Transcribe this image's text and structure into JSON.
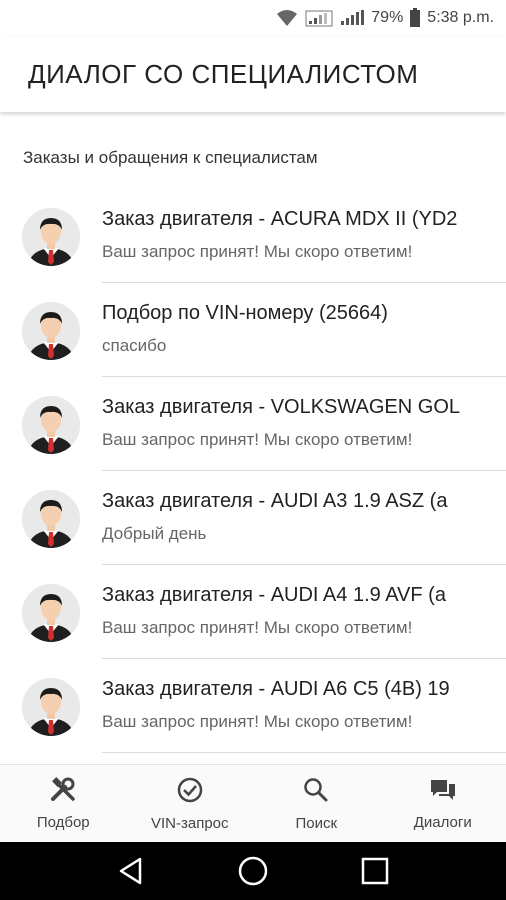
{
  "status_bar": {
    "battery": "79%",
    "time": "5:38 p.m."
  },
  "header": {
    "title": "ДИАЛОГ СО СПЕЦИАЛИСТОМ"
  },
  "main": {
    "section_title": "Заказы и обращения к специалистам",
    "items": [
      {
        "title": "Заказ двигателя - ACURA MDX II (YD2",
        "subtitle": "Ваш запрос принят! Мы скоро ответим!"
      },
      {
        "title": "Подбор по VIN-номеру (25664)",
        "subtitle": "спасибо"
      },
      {
        "title": "Заказ двигателя - VOLKSWAGEN GOL",
        "subtitle": "Ваш запрос принят! Мы скоро ответим!"
      },
      {
        "title": "Заказ двигателя - AUDI A3 1.9 ASZ (a",
        "subtitle": "Добрый день"
      },
      {
        "title": "Заказ двигателя - AUDI A4 1.9 AVF (a",
        "subtitle": "Ваш запрос принят! Мы скоро ответим!"
      },
      {
        "title": "Заказ двигателя - AUDI A6 C5 (4B) 19",
        "subtitle": "Ваш запрос принят! Мы скоро ответим!"
      }
    ]
  },
  "bottom_nav": {
    "items": [
      {
        "label": "Подбор",
        "icon": "tools-icon"
      },
      {
        "label": "VIN-запрос",
        "icon": "check-circle-icon"
      },
      {
        "label": "Поиск",
        "icon": "search-icon"
      },
      {
        "label": "Диалоги",
        "icon": "chat-icon"
      }
    ]
  },
  "colors": {
    "background": "#ffffff",
    "system_nav": "#000000",
    "divider": "#dcdcdc",
    "avatar_tie": "#d32f2f"
  }
}
